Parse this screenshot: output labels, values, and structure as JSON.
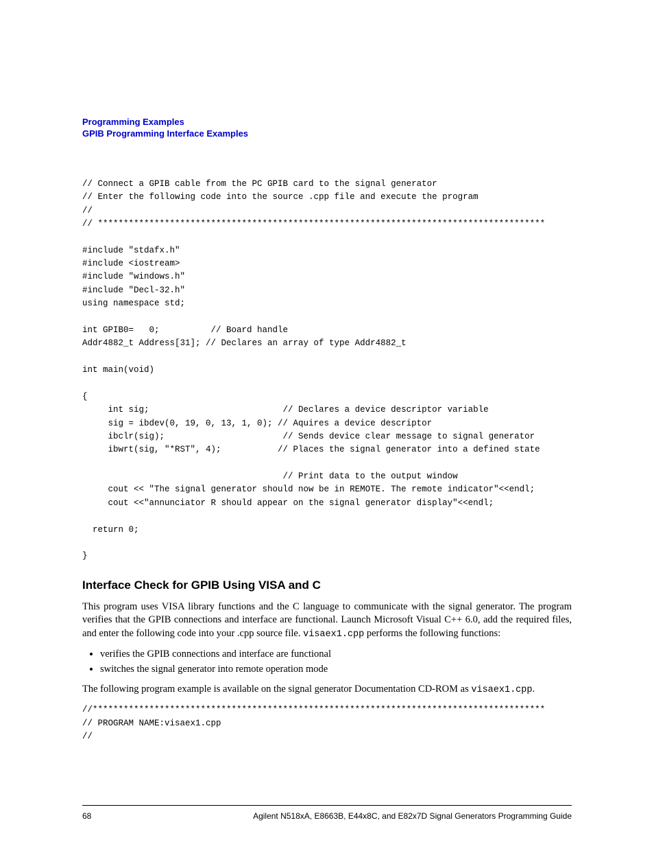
{
  "header": {
    "line1": "Programming Examples",
    "line2": "GPIB Programming Interface Examples"
  },
  "code1": "// Connect a GPIB cable from the PC GPIB card to the signal generator\n// Enter the following code into the source .cpp file and execute the program\n//\n// ***************************************************************************************\n\n#include \"stdafx.h\"\n#include <iostream>\n#include \"windows.h\"\n#include \"Decl-32.h\"\nusing namespace std;\n\nint GPIB0=   0;          // Board handle\nAddr4882_t Address[31]; // Declares an array of type Addr4882_t\n\nint main(void)\n\n{\n     int sig;                          // Declares a device descriptor variable\n     sig = ibdev(0, 19, 0, 13, 1, 0); // Aquires a device descriptor\n     ibclr(sig);                       // Sends device clear message to signal generator\n     ibwrt(sig, \"*RST\", 4);           // Places the signal generator into a defined state\n\n                                       // Print data to the output window\n     cout << \"The signal generator should now be in REMOTE. The remote indicator\"<<endl;\n     cout <<\"annunciator R should appear on the signal generator display\"<<endl;\n\n  return 0;\n\n}",
  "section_heading": "Interface Check for GPIB Using VISA and C",
  "para1_a": "This program uses VISA library functions and the C language to communicate with the signal generator. The program verifies that the GPIB connections and interface are functional. Launch Microsoft Visual C++ 6.0, add the required files, and enter the following code into your .cpp source file. ",
  "para1_file": "visaex1.cpp",
  "para1_b": " performs the following functions:",
  "bullets": {
    "b1": "verifies the GPIB connections and interface are functional",
    "b2": "switches the signal generator into remote operation mode"
  },
  "para2_a": "The following program example is available on the signal generator Documentation CD-ROM as ",
  "para2_file": "visaex1.cpp",
  "para2_b": ".",
  "code2": "//****************************************************************************************\n// PROGRAM NAME:visaex1.cpp\n// ",
  "footer": {
    "pagenum": "68",
    "guide": "Agilent N518xA, E8663B, E44x8C, and E82x7D Signal Generators Programming Guide"
  }
}
